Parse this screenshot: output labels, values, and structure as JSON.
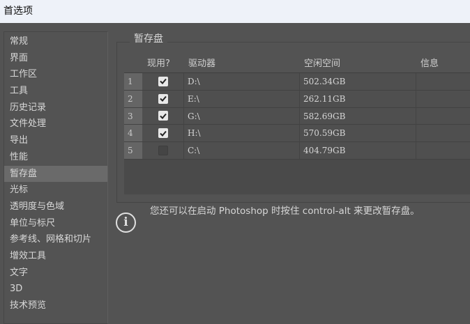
{
  "window": {
    "title": "首选项"
  },
  "sidebar": {
    "items": [
      "常规",
      "界面",
      "工作区",
      "工具",
      "历史记录",
      "文件处理",
      "导出",
      "性能",
      "暂存盘",
      "光标",
      "透明度与色域",
      "单位与标尺",
      "参考线、网格和切片",
      "增效工具",
      "文字",
      "3D",
      "技术预览"
    ],
    "selected": "暂存盘"
  },
  "scratch": {
    "legend": "暂存盘",
    "headers": {
      "active": "现用?",
      "drive": "驱动器",
      "free": "空闲空间",
      "info": "信息"
    },
    "rows": [
      {
        "num": "1",
        "checked": true,
        "drive": "D:\\",
        "free": "502.34GB",
        "info": ""
      },
      {
        "num": "2",
        "checked": true,
        "drive": "E:\\",
        "free": "262.11GB",
        "info": ""
      },
      {
        "num": "3",
        "checked": true,
        "drive": "G:\\",
        "free": "582.69GB",
        "info": ""
      },
      {
        "num": "4",
        "checked": true,
        "drive": "H:\\",
        "free": "570.59GB",
        "info": ""
      },
      {
        "num": "5",
        "checked": false,
        "drive": "C:\\",
        "free": "404.79GB",
        "info": ""
      }
    ]
  },
  "hint": "您还可以在启动 Photoshop 时按住 control-alt 来更改暂存盘。"
}
